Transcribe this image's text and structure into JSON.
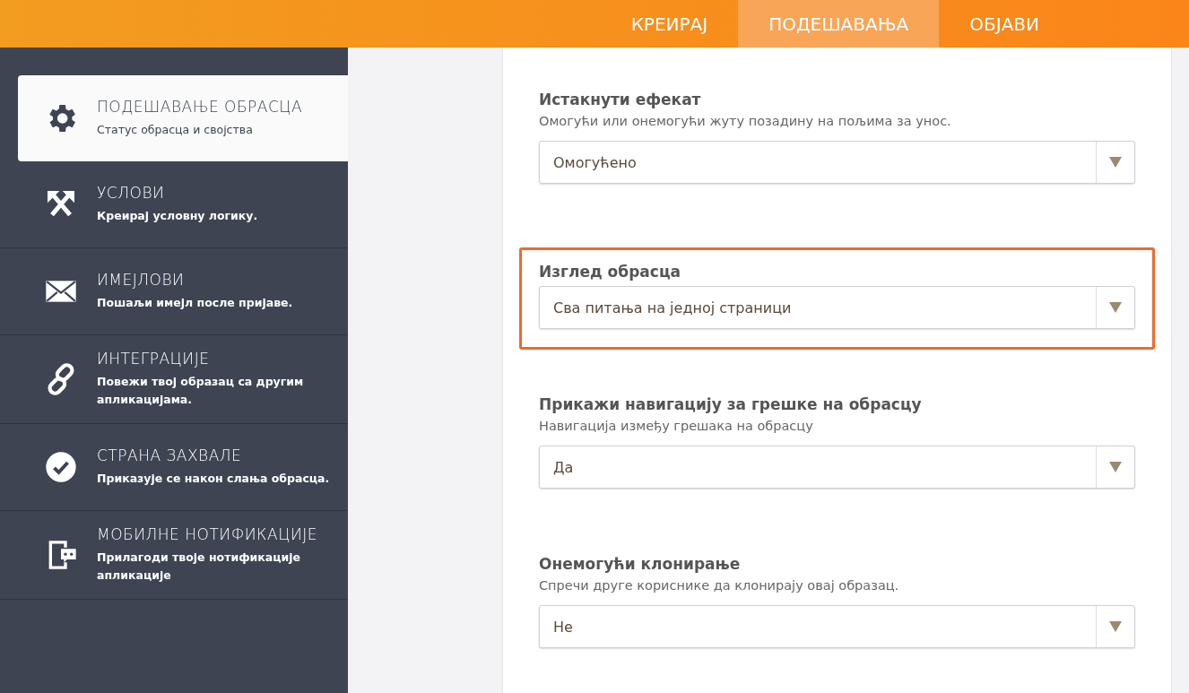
{
  "top_tabs": [
    {
      "label": "КРЕИРАЈ",
      "selected": false
    },
    {
      "label": "ПОДЕШАВАЊА",
      "selected": true
    },
    {
      "label": "ОБЈАВИ",
      "selected": false
    }
  ],
  "sidebar": {
    "items": [
      {
        "title": "ПОДЕШАВАЊЕ ОБРАСЦА",
        "subtitle": "Статус обрасца и својства",
        "selected": true
      },
      {
        "title": "УСЛОВИ",
        "subtitle": "Креирај условну логику.",
        "selected": false
      },
      {
        "title": "ИМЕЈЛОВИ",
        "subtitle": "Пошаљи имејл после пријаве.",
        "selected": false
      },
      {
        "title": "ИНТЕГРАЦИЈЕ",
        "subtitle": "Повежи твој образац са другим апликацијама.",
        "selected": false
      },
      {
        "title": "СТРАНА ЗАХВАЛЕ",
        "subtitle": "Приказује се након слања обрасца.",
        "selected": false
      },
      {
        "title": "МОБИЛНЕ НОТИФИКАЦИЈЕ",
        "subtitle": "Прилагоди твоје нотификације апликације",
        "selected": false
      }
    ]
  },
  "settings": [
    {
      "title": "Истакнути ефекат",
      "description": "Омогући или онемогући жуту позадину на пољима за унос.",
      "value": "Омогућено",
      "highlighted": false
    },
    {
      "title": "Изглед обрасца",
      "value": "Сва питања на једној страници",
      "highlighted": true
    },
    {
      "title": "Прикажи навигацију за грешке на обрасцу",
      "description": "Навигација између грешака на обрасцу",
      "value": "Да",
      "highlighted": false
    },
    {
      "title": "Онемогући клонирање",
      "description": "Спречи друге кориснике да клонирају овај образац.",
      "value": "Не",
      "highlighted": false
    }
  ]
}
